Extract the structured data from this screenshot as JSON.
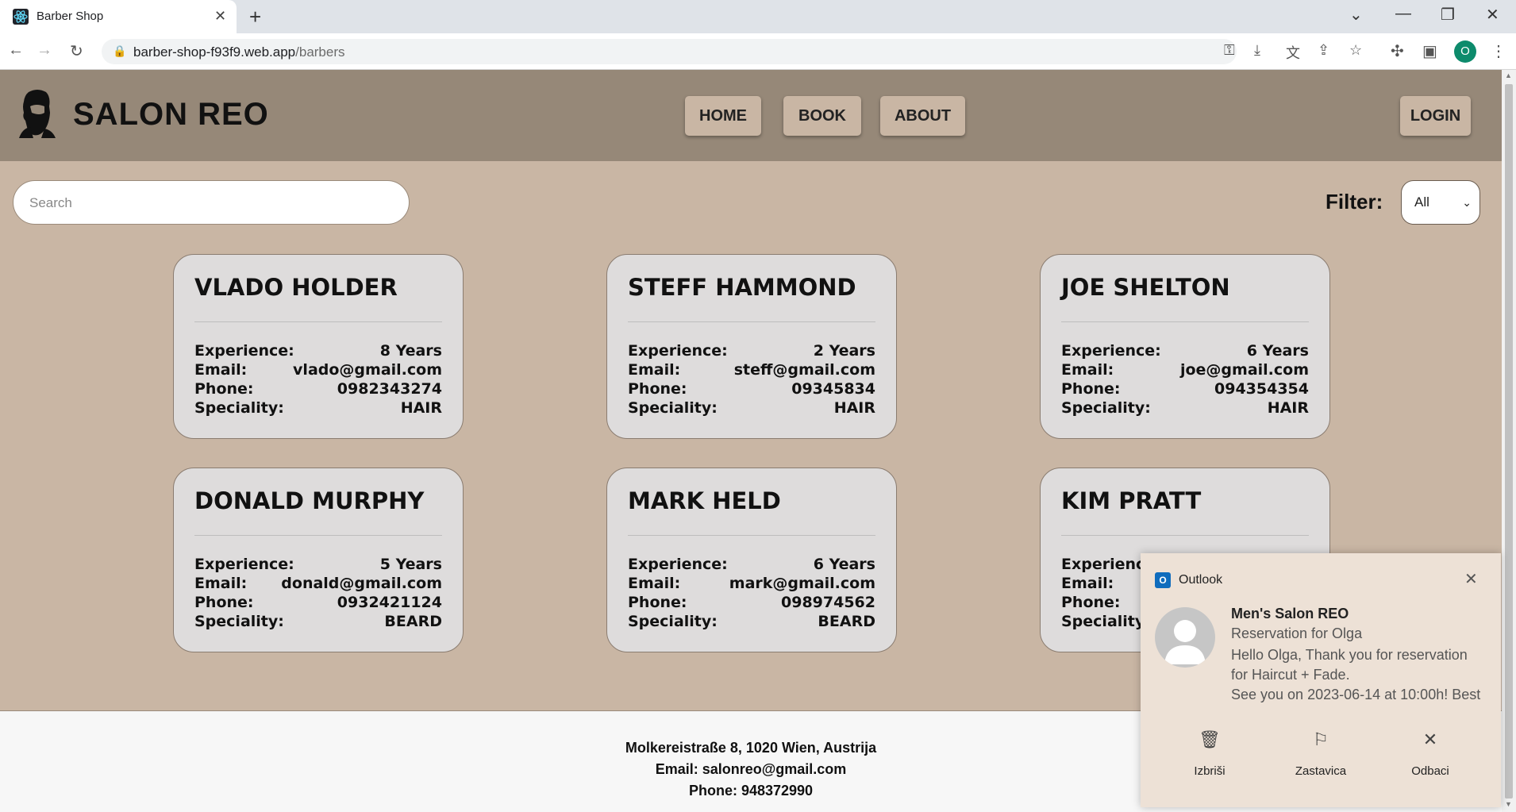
{
  "browser": {
    "tab_title": "Barber Shop",
    "url_host": "barber-shop-f93f9.web.app",
    "url_path": "/barbers",
    "profile_initial": "O"
  },
  "header": {
    "brand": "SALON REO",
    "nav": [
      {
        "label": "HOME"
      },
      {
        "label": "BOOK"
      },
      {
        "label": "ABOUT"
      }
    ],
    "login_label": "LOGIN"
  },
  "toolbar": {
    "search_placeholder": "Search",
    "filter_label": "Filter:",
    "filter_value": "All"
  },
  "labels": {
    "experience": "Experience:",
    "email": "Email:",
    "phone": "Phone:",
    "speciality": "Speciality:"
  },
  "barbers": [
    {
      "name": "VLADO HOLDER",
      "experience": "8 Years",
      "email": "vlado@gmail.com",
      "phone": "0982343274",
      "speciality": "HAIR"
    },
    {
      "name": "STEFF HAMMOND",
      "experience": "2 Years",
      "email": "steff@gmail.com",
      "phone": "09345834",
      "speciality": "HAIR"
    },
    {
      "name": "JOE SHELTON",
      "experience": "6 Years",
      "email": "joe@gmail.com",
      "phone": "094354354",
      "speciality": "HAIR"
    },
    {
      "name": "DONALD MURPHY",
      "experience": "5 Years",
      "email": "donald@gmail.com",
      "phone": "0932421124",
      "speciality": "BEARD"
    },
    {
      "name": "MARK HELD",
      "experience": "6 Years",
      "email": "mark@gmail.com",
      "phone": "098974562",
      "speciality": "BEARD"
    },
    {
      "name": "KIM PRATT",
      "experience": "",
      "email": "",
      "phone": "",
      "speciality": ""
    }
  ],
  "footer": {
    "address": "Molkereistraße 8, 1020 Wien, Austrija",
    "email": "Email: salonreo@gmail.com",
    "phone": "Phone: 948372990"
  },
  "notification": {
    "app": "Outlook",
    "sender": "Men's Salon REO",
    "subject": "Reservation for Olga",
    "body_lines": [
      "Hello Olga,  Thank you for reservation",
      "for Haircut + Fade.",
      "See you on 2023-06-14 at 10:00h!  Best"
    ],
    "actions": [
      {
        "label": "Izbriši",
        "icon": "trash-icon"
      },
      {
        "label": "Zastavica",
        "icon": "flag-icon"
      },
      {
        "label": "Odbaci",
        "icon": "close-icon"
      }
    ]
  },
  "colors": {
    "header_bg": "#968878",
    "page_bg": "#c9b6a4",
    "card_bg": "#dedcdc",
    "footer_bg": "#f7f7f7"
  }
}
